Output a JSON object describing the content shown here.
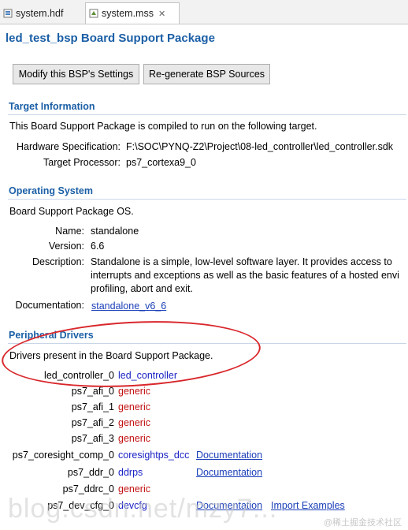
{
  "tabs": [
    {
      "label": "system.hdf"
    },
    {
      "label": "system.mss",
      "close": "✕"
    }
  ],
  "page_title": "led_test_bsp Board Support Package",
  "buttons": {
    "modify": "Modify this BSP's Settings",
    "regenerate": "Re-generate BSP Sources"
  },
  "target": {
    "heading": "Target Information",
    "intro": "This Board Support Package is compiled to run on the following target.",
    "hw_label": "Hardware Specification:",
    "hw_value": "F:\\SOC\\PYNQ-Z2\\Project\\08-led_controller\\led_controller.sdk",
    "proc_label": "Target Processor:",
    "proc_value": "ps7_cortexa9_0"
  },
  "os": {
    "heading": "Operating System",
    "intro": "Board Support Package OS.",
    "name_label": "Name:",
    "name_value": "standalone",
    "version_label": "Version:",
    "version_value": "6.6",
    "desc_label": "Description:",
    "desc_line1": "Standalone is a simple, low-level software layer. It provides access to",
    "desc_line2": "interrupts and exceptions as well as the basic features of a hosted envi",
    "desc_line3": "profiling, abort and exit.",
    "doc_label": "Documentation:",
    "doc_link": "standalone_v6_6"
  },
  "drivers": {
    "heading": "Peripheral Drivers",
    "intro": "Drivers present in the Board Support Package.",
    "rows": [
      {
        "name": "led_controller_0",
        "driver": "led_controller",
        "doc": "",
        "extra": ""
      },
      {
        "name": "ps7_afi_0",
        "driver": "generic",
        "doc": "",
        "extra": ""
      },
      {
        "name": "ps7_afi_1",
        "driver": "generic",
        "doc": "",
        "extra": ""
      },
      {
        "name": "ps7_afi_2",
        "driver": "generic",
        "doc": "",
        "extra": ""
      },
      {
        "name": "ps7_afi_3",
        "driver": "generic",
        "doc": "",
        "extra": ""
      },
      {
        "name": "ps7_coresight_comp_0",
        "driver": "coresightps_dcc",
        "doc": "Documentation",
        "extra": ""
      },
      {
        "name": "ps7_ddr_0",
        "driver": "ddrps",
        "doc": "Documentation",
        "extra": ""
      },
      {
        "name": "ps7_ddrc_0",
        "driver": "generic",
        "doc": "",
        "extra": ""
      },
      {
        "name": "ps7_dev_cfg_0",
        "driver": "devcfg",
        "doc": "Documentation",
        "extra": "Import Examples"
      }
    ]
  },
  "watermark": {
    "main": "blog.csdn.net/mzy7...",
    "corner": "@稀土掘金技术社区"
  },
  "colors": {
    "heading": "#1b5fa6",
    "generic_driver": "#c21010",
    "custom_driver": "#1a23c4",
    "annotation": "#d9262b"
  }
}
